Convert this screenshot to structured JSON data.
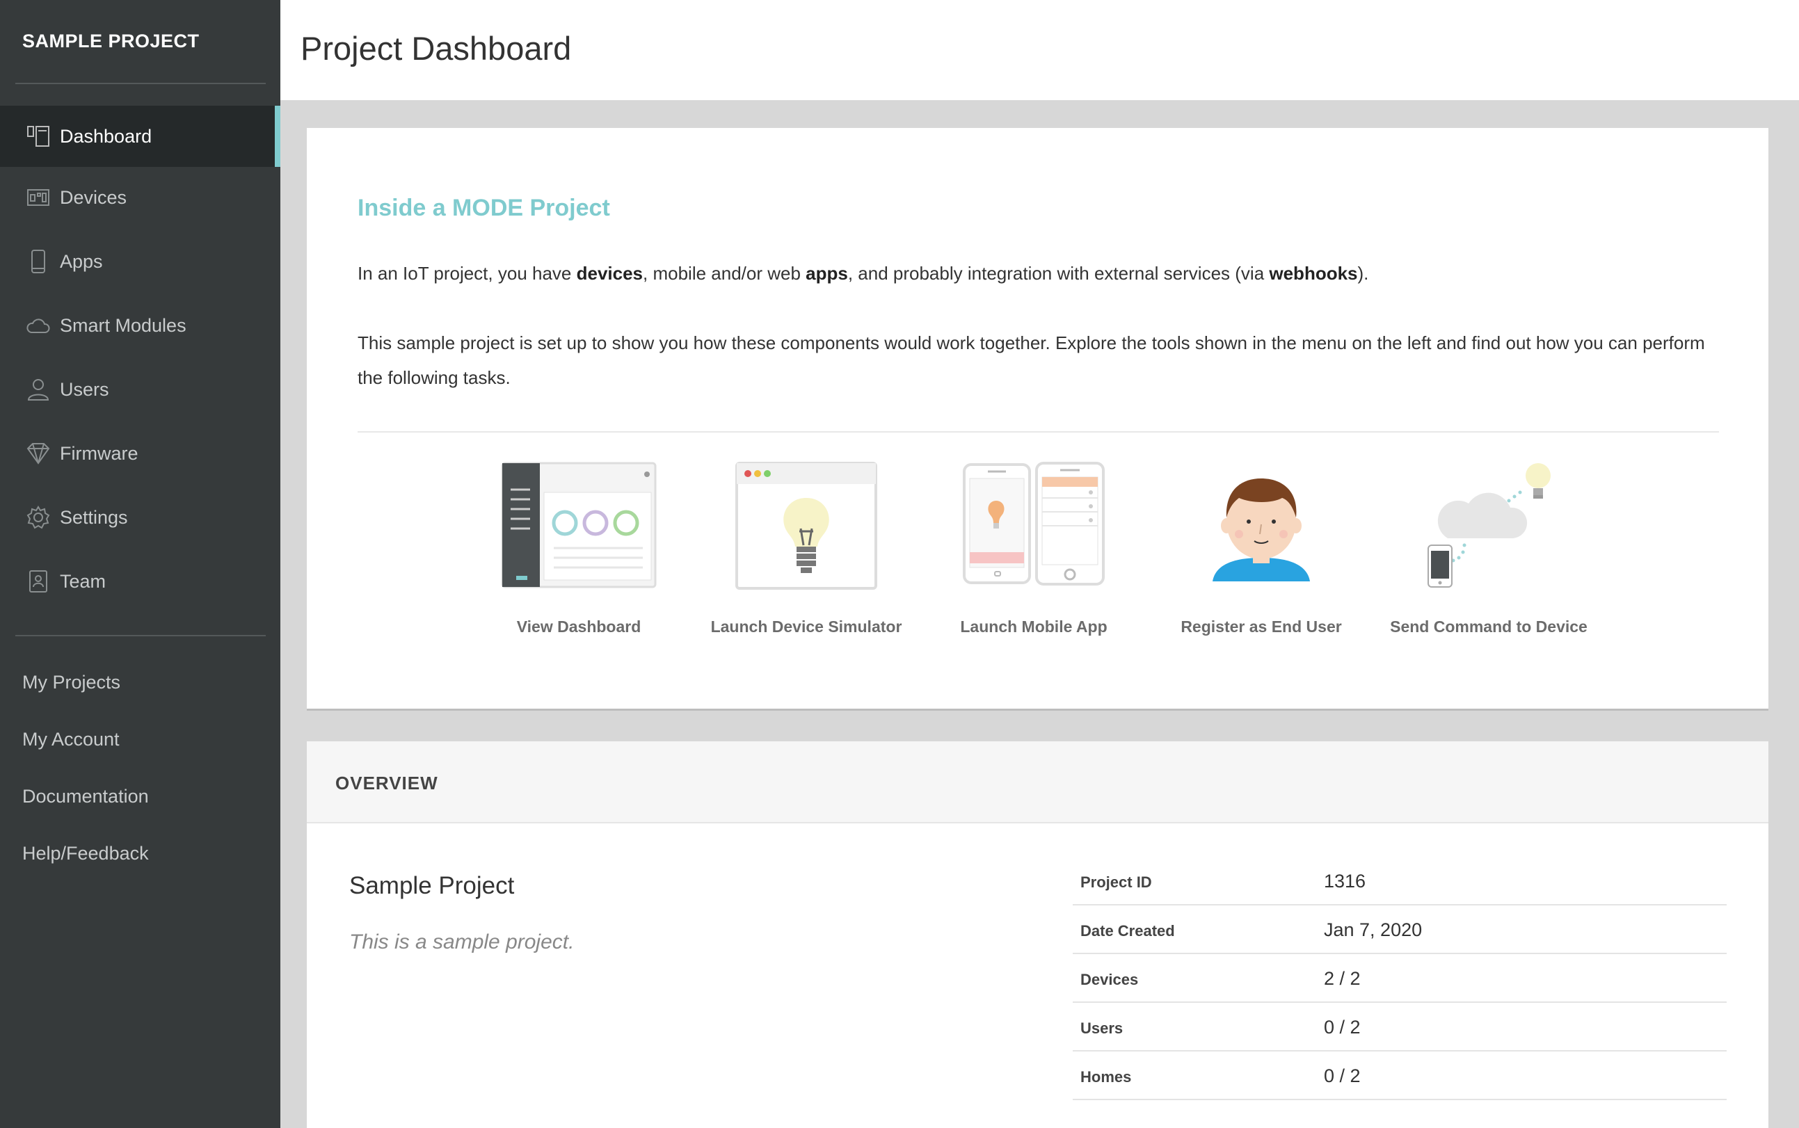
{
  "sidebar": {
    "project_title": "SAMPLE PROJECT",
    "items": [
      {
        "label": "Dashboard",
        "icon": "dashboard-icon"
      },
      {
        "label": "Devices",
        "icon": "devices-icon"
      },
      {
        "label": "Apps",
        "icon": "phone-icon"
      },
      {
        "label": "Smart Modules",
        "icon": "cloud-icon"
      },
      {
        "label": "Users",
        "icon": "user-icon"
      },
      {
        "label": "Firmware",
        "icon": "diamond-icon"
      },
      {
        "label": "Settings",
        "icon": "gear-icon"
      },
      {
        "label": "Team",
        "icon": "badge-icon"
      }
    ],
    "links": [
      "My Projects",
      "My Account",
      "Documentation",
      "Help/Feedback"
    ],
    "accent_color": "#7fcbce"
  },
  "header": {
    "title": "Project Dashboard"
  },
  "intro": {
    "heading": "Inside a MODE Project",
    "p1": {
      "t1": "In an IoT project, you have ",
      "b1": "devices",
      "t2": ", mobile and/or web ",
      "b2": "apps",
      "t3": ", and probably integration with external services (via ",
      "b3": "webhooks",
      "t4": ")."
    },
    "p2": "This sample project is set up to show you how these components would work together. Explore the tools shown in the menu on the left and find out how you can perform the following tasks.",
    "tasks": [
      {
        "label": "View Dashboard",
        "icon": "dashboard-illustration-icon"
      },
      {
        "label": "Launch Device Simulator",
        "icon": "lightbulb-illustration-icon"
      },
      {
        "label": "Launch Mobile App",
        "icon": "mobile-app-illustration-icon"
      },
      {
        "label": "Register as End User",
        "icon": "person-illustration-icon"
      },
      {
        "label": "Send Command to Device",
        "icon": "cloud-command-illustration-icon"
      }
    ]
  },
  "overview": {
    "heading": "OVERVIEW",
    "project_name": "Sample Project",
    "description": "This is a sample project.",
    "rows": [
      {
        "key": "Project ID",
        "value": "1316"
      },
      {
        "key": "Date Created",
        "value": "Jan 7, 2020"
      },
      {
        "key": "Devices",
        "value": "2 / 2"
      },
      {
        "key": "Users",
        "value": "0 / 2"
      },
      {
        "key": "Homes",
        "value": "0 / 2"
      }
    ]
  }
}
